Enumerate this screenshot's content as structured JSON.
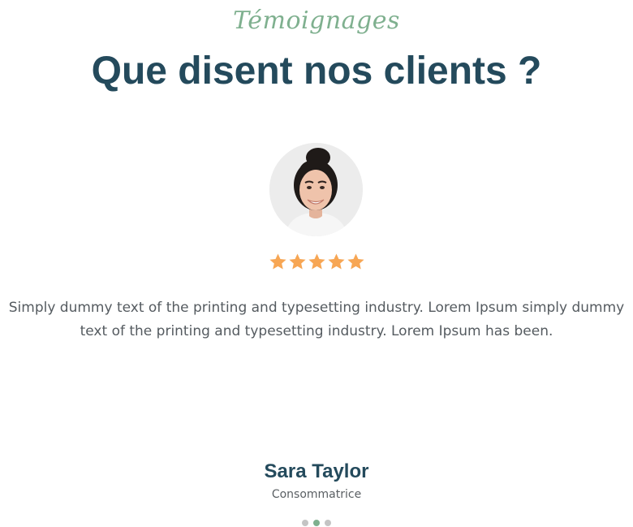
{
  "section": {
    "label": "Témoignages",
    "title": "Que disent nos clients ?"
  },
  "testimonial": {
    "avatar_icon": "avatar-photo",
    "rating": 5,
    "rating_max": 5,
    "star_color": "#f7a654",
    "quote": "Simply dummy text of the printing and typesetting industry. Lorem Ipsum simply dummy text of the printing and typesetting industry. Lorem Ipsum has been.",
    "author_name": "Sara Taylor",
    "author_role": "Consommatrice"
  },
  "carousel": {
    "slide_count": 3,
    "active_index": 1,
    "active_color": "#7fb08f",
    "inactive_color": "#c4c4c4"
  },
  "colors": {
    "accent": "#7fb08f",
    "heading": "#244a5c",
    "body_text": "#555b60"
  }
}
